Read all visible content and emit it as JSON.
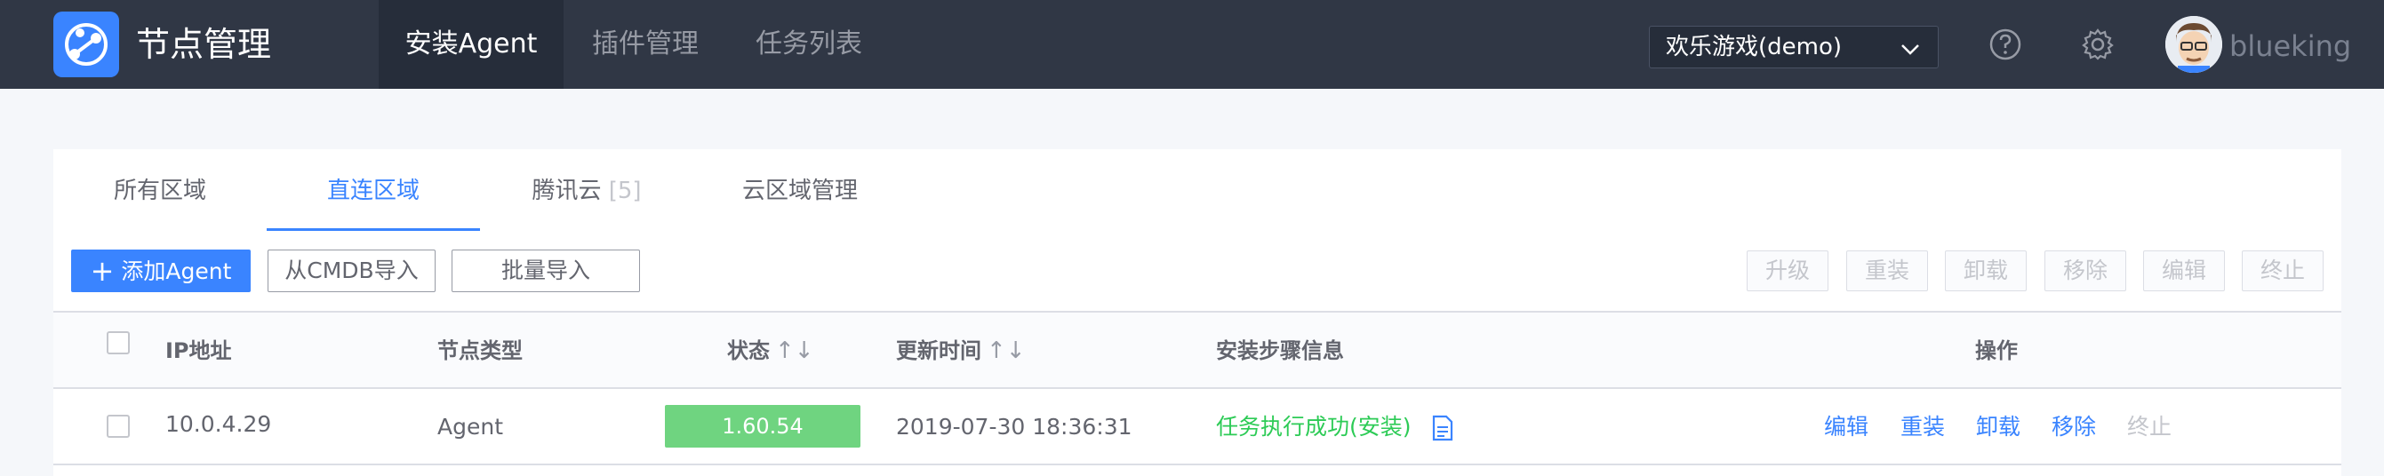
{
  "header": {
    "app_title": "节点管理",
    "nav": [
      "安装Agent",
      "插件管理",
      "任务列表"
    ],
    "business_select": "欢乐游戏(demo)",
    "username": "blueking"
  },
  "tabs": [
    {
      "label": "所有区域"
    },
    {
      "label": "直连区域"
    },
    {
      "label": "腾讯云",
      "count": "[5]"
    },
    {
      "label": "云区域管理"
    }
  ],
  "toolbar": {
    "add_agent": "添加Agent",
    "import_cmdb": "从CMDB导入",
    "batch_import": "批量导入",
    "batch_actions": [
      "升级",
      "重装",
      "卸载",
      "移除",
      "编辑",
      "终止"
    ]
  },
  "table": {
    "columns": [
      "IP地址",
      "节点类型",
      "状态",
      "更新时间",
      "安装步骤信息",
      "操作"
    ],
    "sort_glyph": "↑↓",
    "rows": [
      {
        "ip": "10.0.4.29",
        "type": "Agent",
        "status": "1.60.54",
        "updated": "2019-07-30 18:36:31",
        "step_info": "任务执行成功(安装)",
        "ops": [
          "编辑",
          "重装",
          "卸载",
          "移除",
          "终止"
        ]
      }
    ]
  },
  "colors": {
    "topbar": "#303745",
    "accent": "#3a84ff",
    "success": "#2dcb56",
    "status_bg": "#6fd480"
  }
}
